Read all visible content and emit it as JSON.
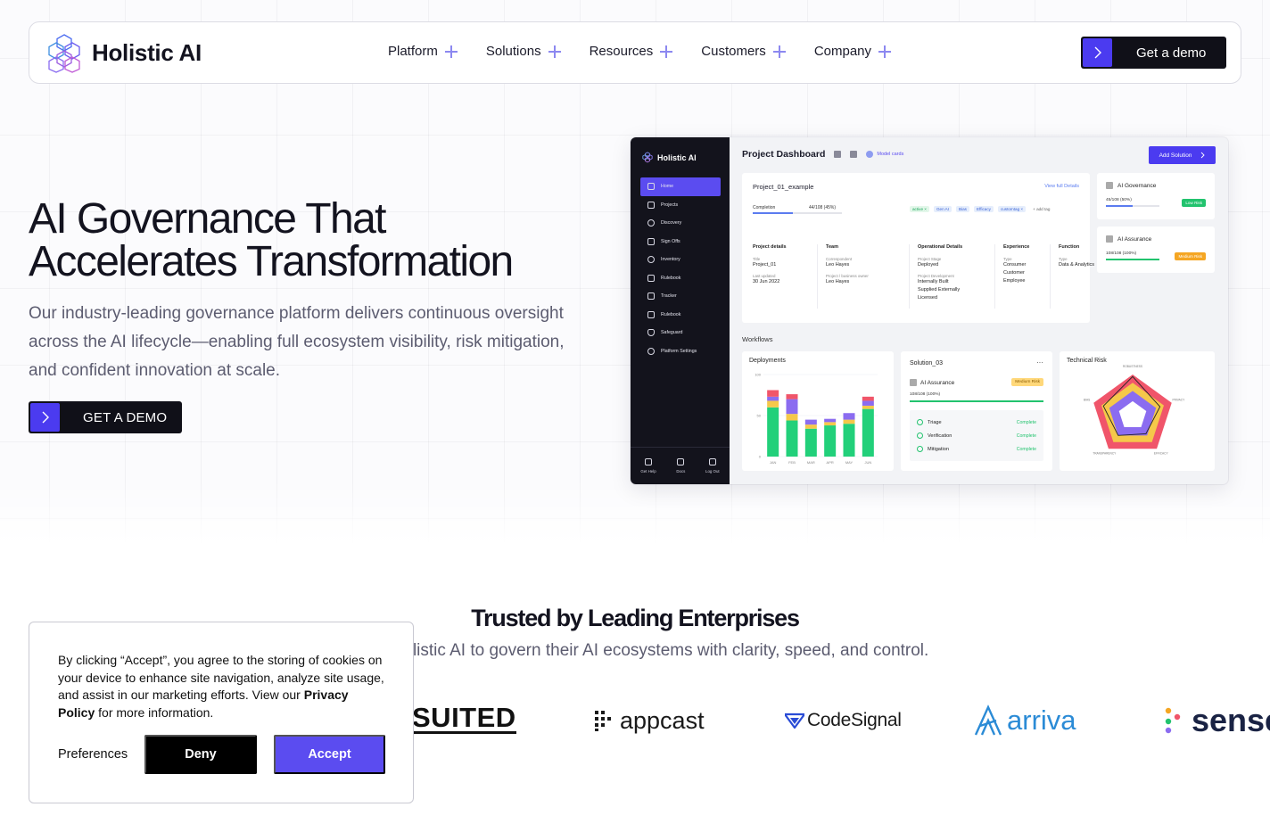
{
  "brand": {
    "name": "Holistic AI",
    "accent": "#4b3bf0"
  },
  "nav": {
    "items": [
      {
        "label": "Platform"
      },
      {
        "label": "Solutions"
      },
      {
        "label": "Resources"
      },
      {
        "label": "Customers"
      },
      {
        "label": "Company"
      }
    ],
    "cta_label": "Get a demo"
  },
  "hero": {
    "title_line1": "AI Governance That",
    "title_line2": "Accelerates Transformation",
    "subtitle": "Our industry-leading governance platform delivers continuous oversight across the AI lifecycle—enabling full ecosystem visibility, risk mitigation, and confident innovation at scale.",
    "cta_label": "GET A DEMO"
  },
  "dashboard": {
    "brand": "Holistic AI",
    "sidebar": [
      "Home",
      "Projects",
      "Discovery",
      "Sign Offs",
      "Inventory",
      "Rulebook",
      "Tracker",
      "Rulebook",
      "Safeguard",
      "Platform Settings"
    ],
    "footer": [
      "Get Help",
      "Docs",
      "Log Out"
    ],
    "title": "Project Dashboard",
    "model_cards": "Model cards",
    "add_solution": "Add Solution",
    "project": {
      "name": "Project_01_example",
      "link": "View full Details",
      "completion_label": "Completion",
      "completion_value": "44/108 (45%)",
      "completion_fraction": 0.45,
      "tags": [
        "active ×",
        "Gen AI",
        "Bias",
        "Efficacy",
        "customtag ×",
        "+ add tag"
      ],
      "details": {
        "heading": "Project details",
        "title_label": "Title",
        "title_value": "Project_01",
        "updated_label": "Last updated",
        "updated_value": "30 Jun 2022"
      },
      "team": {
        "heading": "Team",
        "k1": "Correspondent",
        "v1": "Leo Hayes",
        "k2": "Project / business owner",
        "v2": "Leo Hayes"
      },
      "operational": {
        "heading": "Operational Details",
        "k1": "Project Stage",
        "v1": "Deployed",
        "k2": "Project Development",
        "v2a": "Internally Built",
        "v2b": "Supplied Externally",
        "v2c": "Licensed"
      },
      "experience": {
        "heading": "Experience",
        "k1": "Type",
        "v1": "Consumer",
        "v2": "Customer",
        "v3": "Employee"
      },
      "function": {
        "heading": "Function",
        "k1": "Type",
        "v1": "Data & Analytics"
      }
    },
    "governance": {
      "title": "AI Governance",
      "value": "45/108 (50%)",
      "fraction": 0.5,
      "pill": "Low Risk",
      "pill_color": "#22c36e"
    },
    "assurance": {
      "title": "AI Assurance",
      "value": "108/108 (100%)",
      "fraction": 1.0,
      "pill": "Medium Risk",
      "pill_color": "#f5a623"
    },
    "workflows_label": "Workflows",
    "deployments": {
      "title": "Deployments"
    },
    "solution": {
      "title": "Solution_03",
      "assurance": "AI Assurance",
      "risk": "Medium Risk",
      "value": "108/108 (100%)",
      "steps": [
        {
          "label": "Triage",
          "status": "Complete"
        },
        {
          "label": "Verification",
          "status": "Complete"
        },
        {
          "label": "Mitigation",
          "status": "Complete"
        }
      ]
    },
    "technical_risk": {
      "title": "Technical Risk"
    }
  },
  "chart_data": [
    {
      "type": "bar",
      "title": "Deployments",
      "categories": [
        "JAN",
        "FEB",
        "MAR",
        "APR",
        "MAY",
        "JUN"
      ],
      "ylim": [
        0,
        100
      ],
      "yticks": [
        "100",
        "50",
        "0"
      ],
      "series": [
        {
          "values": [
            60,
            44,
            34,
            38,
            40,
            58
          ],
          "color": "#22d07a"
        },
        {
          "values": [
            8,
            8,
            5,
            4,
            5,
            4
          ],
          "color": "#f5c84a"
        },
        {
          "values": [
            5,
            18,
            6,
            4,
            8,
            6
          ],
          "color": "#8b6cf0"
        },
        {
          "values": [
            8,
            6,
            0,
            0,
            0,
            5
          ],
          "color": "#f0556a"
        }
      ]
    },
    {
      "type": "radar",
      "title": "Technical Risk",
      "axes": [
        "ROBUSTNESS",
        "PRIVACY",
        "EFFICACY",
        "TRANSPARENCY",
        "BIAS"
      ],
      "rings": [
        {
          "level": 1.0,
          "color": "#f0556a"
        },
        {
          "level": 0.8,
          "color": "#f5c84a"
        },
        {
          "level": 0.6,
          "color": "#8b6cf0"
        },
        {
          "level": 0.35,
          "color": "#ffffff"
        }
      ],
      "series": [
        {
          "values": [
            0.95,
            0.7,
            0.55,
            0.6,
            0.75
          ],
          "color": "#222"
        }
      ]
    }
  ],
  "trusted": {
    "title": "Trusted by Leading Enterprises",
    "subtitle": "ely on Holistic AI to govern their AI ecosystems with clarity, speed, and control.",
    "logos": [
      "SUITED",
      "appcast",
      "CodeSignal",
      "arriva",
      "sense"
    ]
  },
  "cookie": {
    "text_before": "By clicking “Accept”, you agree to the storing of cookies on your device to enhance site navigation, analyze site usage, and assist in our marketing efforts. View our ",
    "policy_link": "Privacy Policy",
    "text_after": " for more information.",
    "preferences": "Preferences",
    "deny": "Deny",
    "accept": "Accept"
  }
}
